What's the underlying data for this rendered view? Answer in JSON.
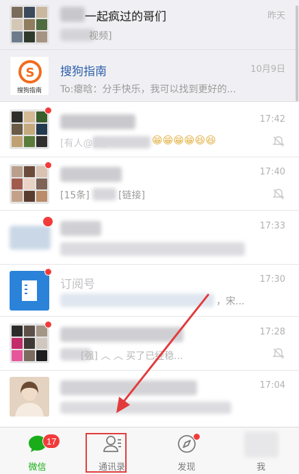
{
  "colors": {
    "accent": "#1aad19",
    "badge": "#f23b3b",
    "arrow": "#e23b3b",
    "sogou_orange": "#f26b1d",
    "subscription_blue": "#2b82d9"
  },
  "chats": [
    {
      "name_visible": "一起疯过的哥们",
      "preview": "视频]",
      "time": "昨天",
      "avatar": "group-grid",
      "pinned": true
    },
    {
      "name": "搜狗指南",
      "preview": "To:瘪晗：分手快乐，我可以找到更好的...",
      "time": "10月9日",
      "avatar": "sogou-logo",
      "logo_text": "搜狗指南",
      "pinned": true
    },
    {
      "preview_fragment": "[有人@我] ",
      "time": "17:42",
      "muted": true,
      "unread_dot": true,
      "emoji": "😁😁😁😁😆😆"
    },
    {
      "preview_prefix": "[15条]",
      "preview_suffix": "[链接]",
      "time": "17:40",
      "muted": true,
      "unread_dot": true
    },
    {
      "time": "17:33",
      "unread_dot": true
    },
    {
      "name": "订阅号",
      "preview_fragment": "，宋...",
      "time": "17:30",
      "unread_dot": true,
      "avatar": "subscription-icon"
    },
    {
      "preview_fragment": "[强] ︿ ︿ 买了已经稳...",
      "time": "17:28",
      "muted": true,
      "unread_dot": true
    },
    {
      "time": "17:04",
      "avatar": "person-photo"
    }
  ],
  "tabs": [
    {
      "label": "微信",
      "icon": "chat-bubble-icon",
      "active": true,
      "badge": "17"
    },
    {
      "label": "通讯录",
      "icon": "contacts-icon",
      "active": false
    },
    {
      "label": "发现",
      "icon": "compass-icon",
      "active": false,
      "dot": true
    },
    {
      "label": "我",
      "icon": "me-icon",
      "active": false
    }
  ]
}
